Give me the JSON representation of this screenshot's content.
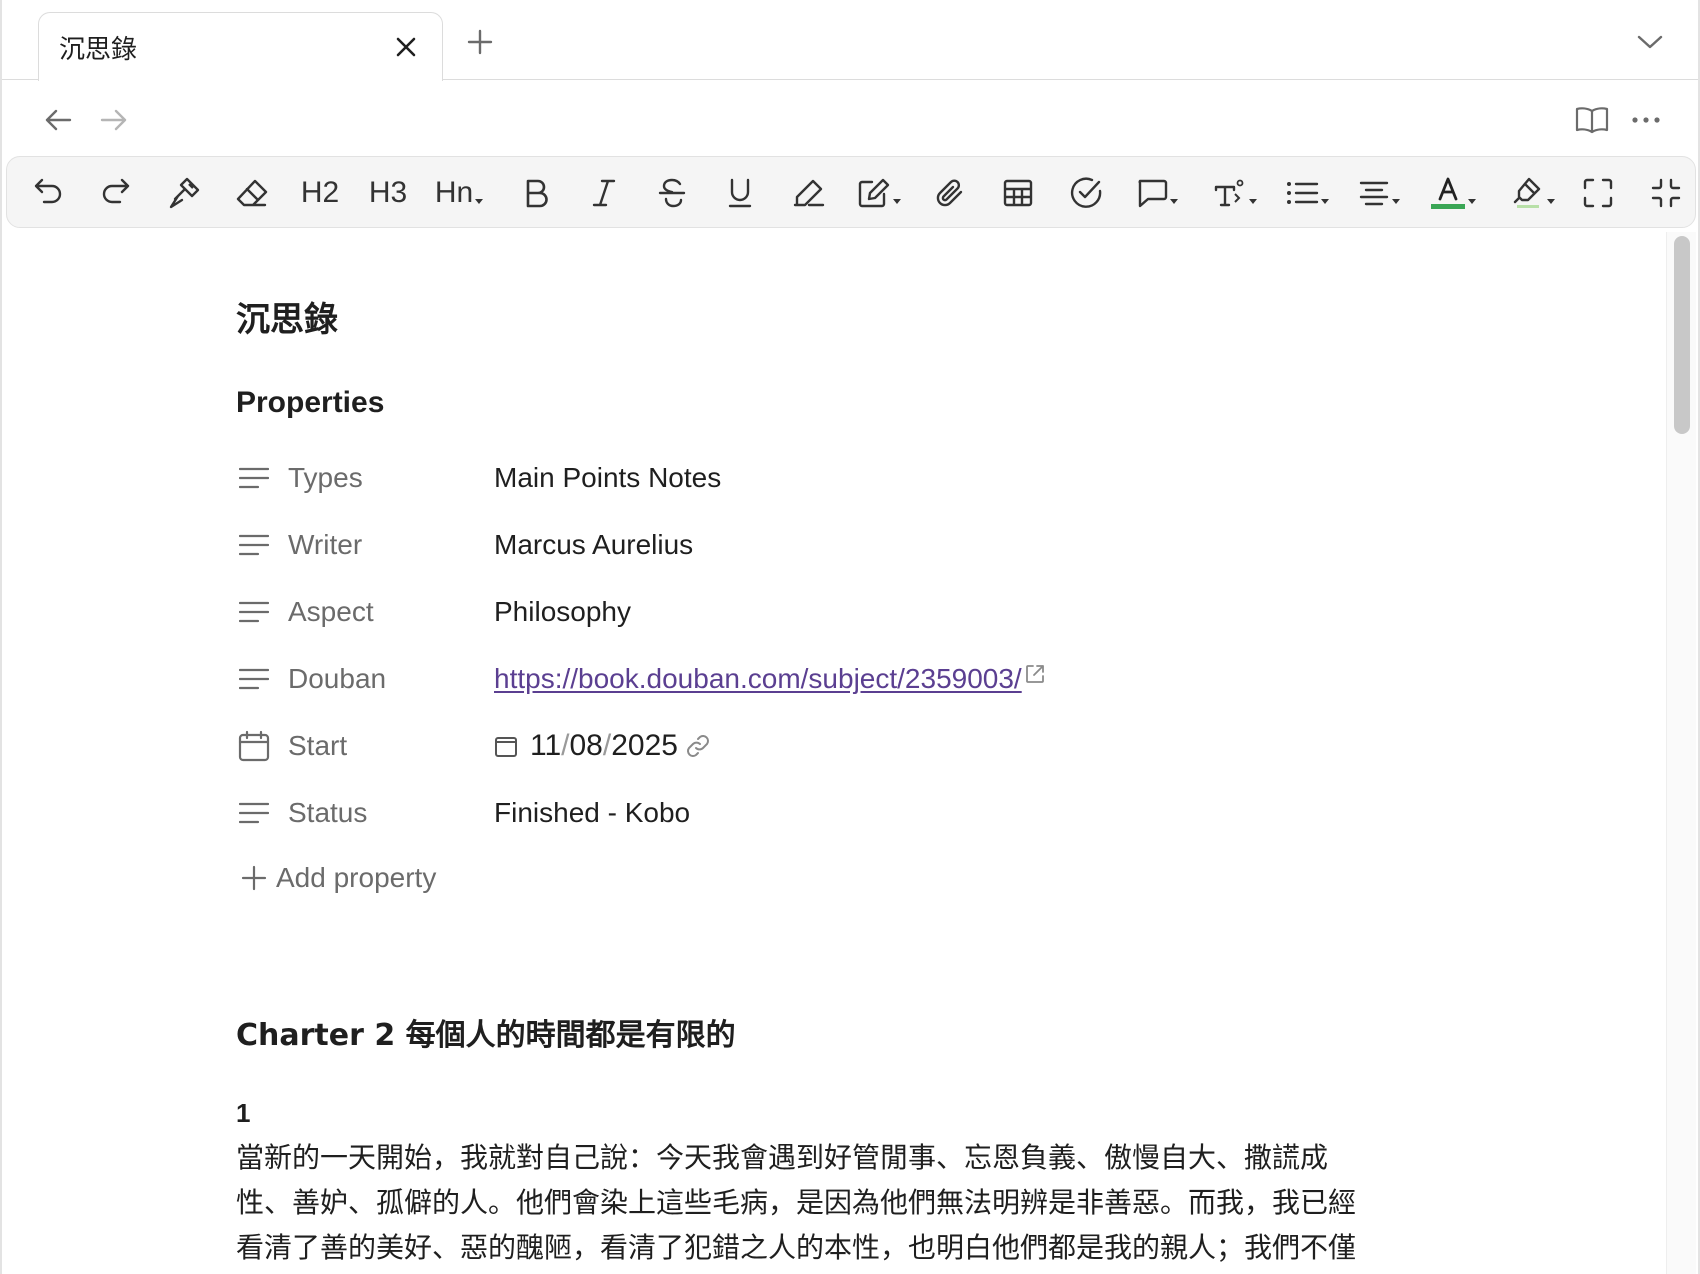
{
  "tab": {
    "title": "沉思錄"
  },
  "document": {
    "title": "沉思錄",
    "properties_heading": "Properties",
    "properties": [
      {
        "key": "Types",
        "value": "Main Points Notes",
        "icon": "text-lines-icon"
      },
      {
        "key": "Writer",
        "value": "Marcus Aurelius",
        "icon": "text-lines-icon"
      },
      {
        "key": "Aspect",
        "value": "Philosophy",
        "icon": "text-lines-icon"
      },
      {
        "key": "Douban",
        "value": "https://book.douban.com/subject/2359003/",
        "icon": "text-lines-icon"
      },
      {
        "key": "Start",
        "date_day": "11",
        "date_month": "08",
        "date_year": "2025",
        "sep": "/",
        "icon": "calendar-icon"
      },
      {
        "key": "Status",
        "value": "Finished - Kobo",
        "icon": "text-lines-icon"
      }
    ],
    "add_property": "Add property",
    "section_heading": "Charter 2 每個人的時間都是有限的",
    "paragraph_number": "1",
    "paragraph_lines": [
      "當新的一天開始，我就對自己說：今天我會遇到好管閒事、忘恩負義、傲慢自大、撒謊成",
      "性、善妒、孤僻的人。他們會染上這些毛病，是因為他們無法明辨是非善惡。而我，我已經",
      "看清了善的美好、惡的醜陋，看清了犯錯之人的本性，也明白他們都是我的親人；我們不僅"
    ]
  },
  "toolbar": {
    "h2": "H2",
    "h3": "H3",
    "hn": "Hn",
    "text_color": "#3aa655",
    "highlight_color": "#b8e0a8"
  }
}
